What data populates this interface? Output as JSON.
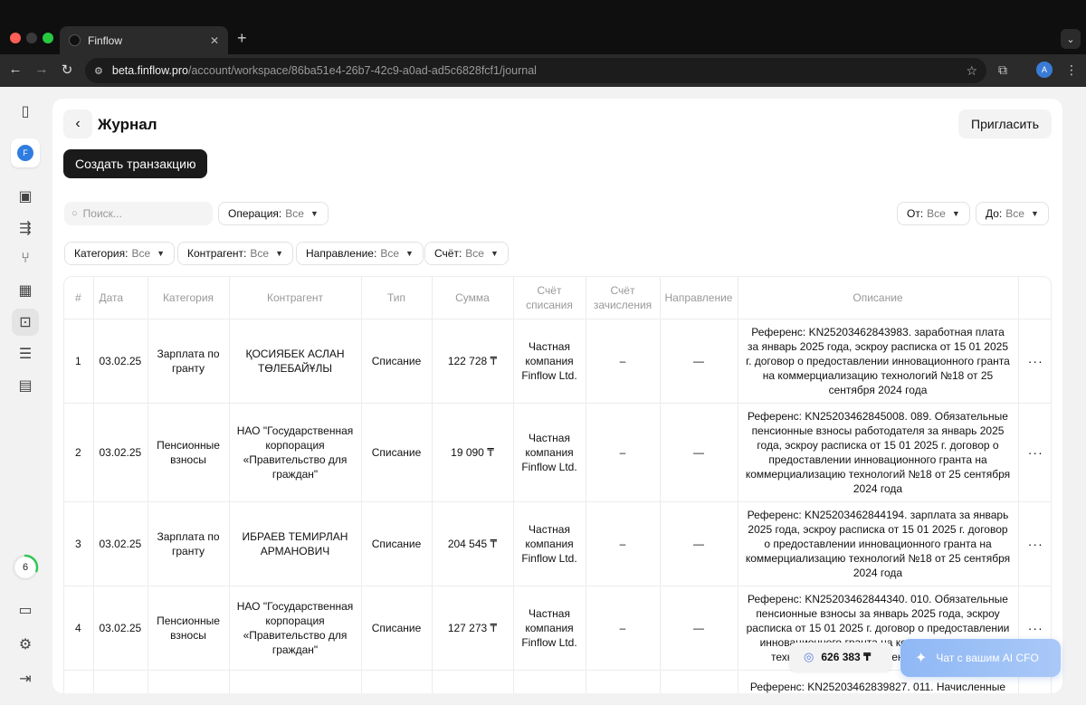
{
  "browser": {
    "tab_title": "Finflow",
    "url_host": "beta.finflow.pro",
    "url_path": "/account/workspace/86ba51e4-26b7-42c9-a0ad-ad5c6828fcf1/journal",
    "profile_initial": "A"
  },
  "sidebar": {
    "workspace_initial": "F",
    "progress_count": "6",
    "progress_fraction": 0.3
  },
  "header": {
    "title": "Журнал",
    "invite_label": "Пригласить",
    "create_label": "Создать транзакцию"
  },
  "filters": {
    "search_placeholder": "Поиск...",
    "operation": {
      "label": "Операция:",
      "value": "Все"
    },
    "from": {
      "label": "От:",
      "value": "Все"
    },
    "to": {
      "label": "До:",
      "value": "Все"
    },
    "category": {
      "label": "Категория:",
      "value": "Все"
    },
    "counterparty": {
      "label": "Контрагент:",
      "value": "Все"
    },
    "direction": {
      "label": "Направление:",
      "value": "Все"
    },
    "account": {
      "label": "Счёт:",
      "value": "Все"
    }
  },
  "table": {
    "columns": [
      "#",
      "Дата",
      "Категория",
      "Контрагент",
      "Тип",
      "Сумма",
      "Счёт списания",
      "Счёт зачисления",
      "Направление",
      "Описание",
      ""
    ],
    "rows": [
      {
        "num": "1",
        "date": "03.02.25",
        "category": "Зарплата по гранту",
        "counterparty": "ҚОСИЯБЕК АСЛАН ТӨЛЕБАЙҰЛЫ",
        "type": "Списание",
        "amount": "122 728 ₸",
        "debit_account": "Частная компания Finflow Ltd.",
        "credit_account": "–",
        "direction": "—",
        "description": "Референс: KN25203462843983. заработная плата за январь 2025 года, эскроу расписка от 15 01 2025 г. договор о предоставлении инновационного гранта на коммерциализацию технологий №18 от 25 сентября 2024 года"
      },
      {
        "num": "2",
        "date": "03.02.25",
        "category": "Пенсионные взносы",
        "counterparty": "НАО \"Государственная корпорация «Правительство для граждан\"",
        "type": "Списание",
        "amount": "19 090 ₸",
        "debit_account": "Частная компания Finflow Ltd.",
        "credit_account": "–",
        "direction": "—",
        "description": "Референс: KN25203462845008. 089. Обязательные пенсионные взносы работодателя за январь 2025 года, эскроу расписка от 15 01 2025 г. договор о предоставлении инновационного гранта на коммерциализацию технологий №18 от 25 сентября 2024 года"
      },
      {
        "num": "3",
        "date": "03.02.25",
        "category": "Зарплата по гранту",
        "counterparty": "ИБРАЕВ ТЕМИРЛАН АРМАНОВИЧ",
        "type": "Списание",
        "amount": "204 545 ₸",
        "debit_account": "Частная компания Finflow Ltd.",
        "credit_account": "–",
        "direction": "—",
        "description": "Референс: KN25203462844194. зарплата за январь 2025 года, эскроу расписка от 15 01 2025 г. договор о предоставлении инновационного гранта на коммерциализацию технологий №18 от 25 сентября 2024 года"
      },
      {
        "num": "4",
        "date": "03.02.25",
        "category": "Пенсионные взносы",
        "counterparty": "НАО \"Государственная корпорация «Правительство для граждан\"",
        "type": "Списание",
        "amount": "127 273 ₸",
        "debit_account": "Частная компания Finflow Ltd.",
        "credit_account": "–",
        "direction": "—",
        "description": "Референс: KN25203462844340. 010. Обязательные пенсионные взносы за январь 2025 года, эскроу расписка от 15 01 2025 г. договор о предоставлении инновационного гранта на коммерциализацию технологий №18 от 25 сентября 2024 года"
      },
      {
        "num": "",
        "date": "",
        "category": "",
        "counterparty": "",
        "type": "",
        "amount": "",
        "debit_account": "",
        "credit_account": "",
        "direction": "",
        "description": "Референс: KN25203462839827. 011. Начисленные"
      }
    ]
  },
  "footer": {
    "balance": "626 383 ₸",
    "ai_label": "Чат с вашим AI CFO"
  }
}
